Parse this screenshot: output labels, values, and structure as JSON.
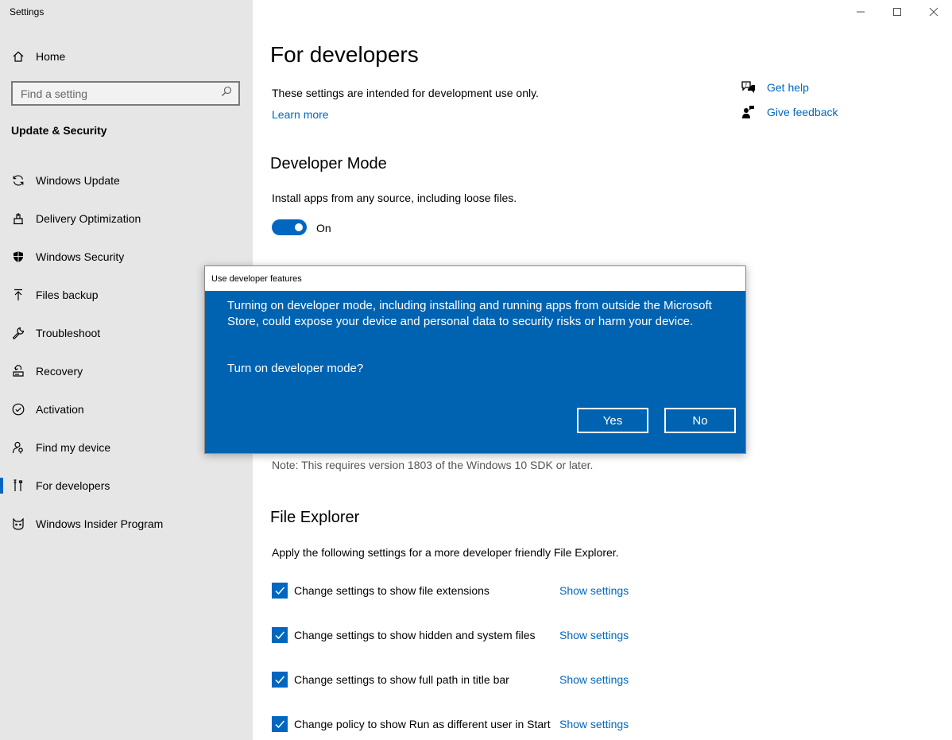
{
  "window": {
    "title": "Settings"
  },
  "sidebar": {
    "home_label": "Home",
    "search_placeholder": "Find a setting",
    "section_title": "Update & Security",
    "items": [
      {
        "label": "Windows Update",
        "icon": "refresh-icon"
      },
      {
        "label": "Delivery Optimization",
        "icon": "delivery-icon"
      },
      {
        "label": "Windows Security",
        "icon": "shield-icon"
      },
      {
        "label": "Files backup",
        "icon": "upload-arrow-icon"
      },
      {
        "label": "Troubleshoot",
        "icon": "wrench-icon"
      },
      {
        "label": "Recovery",
        "icon": "recovery-icon"
      },
      {
        "label": "Activation",
        "icon": "check-circle-icon"
      },
      {
        "label": "Find my device",
        "icon": "person-pin-icon"
      },
      {
        "label": "For developers",
        "icon": "developer-tools-icon",
        "selected": true
      },
      {
        "label": "Windows Insider Program",
        "icon": "insider-cat-icon"
      }
    ]
  },
  "main": {
    "title": "For developers",
    "intro": "These settings are intended for development use only.",
    "learn_more": "Learn more",
    "help": {
      "get_help": "Get help",
      "give_feedback": "Give feedback"
    },
    "developer_mode": {
      "heading": "Developer Mode",
      "description": "Install apps from any source, including loose files.",
      "toggle_state": "On"
    },
    "note": "Note: This requires version 1803 of the Windows 10 SDK or later.",
    "file_explorer": {
      "heading": "File Explorer",
      "description": "Apply the following settings for a more developer friendly File Explorer.",
      "items": [
        {
          "label": "Change settings to show file extensions",
          "link": "Show settings",
          "checked": true
        },
        {
          "label": "Change settings to show hidden and system files",
          "link": "Show settings",
          "checked": true
        },
        {
          "label": "Change settings to show full path in title bar",
          "link": "Show settings",
          "checked": true
        },
        {
          "label": "Change policy to show Run as different user in Start",
          "link": "Show settings",
          "checked": true
        }
      ]
    }
  },
  "dialog": {
    "title": "Use developer features",
    "message": "Turning on developer mode, including installing and running apps from outside the Microsoft Store, could expose your device and personal data to security risks or harm your device.",
    "question": "Turn on developer mode?",
    "yes": "Yes",
    "no": "No"
  },
  "colors": {
    "accent": "#0067c0",
    "dialog_bg": "#0063b1",
    "sidebar_bg": "#e6e6e6"
  }
}
